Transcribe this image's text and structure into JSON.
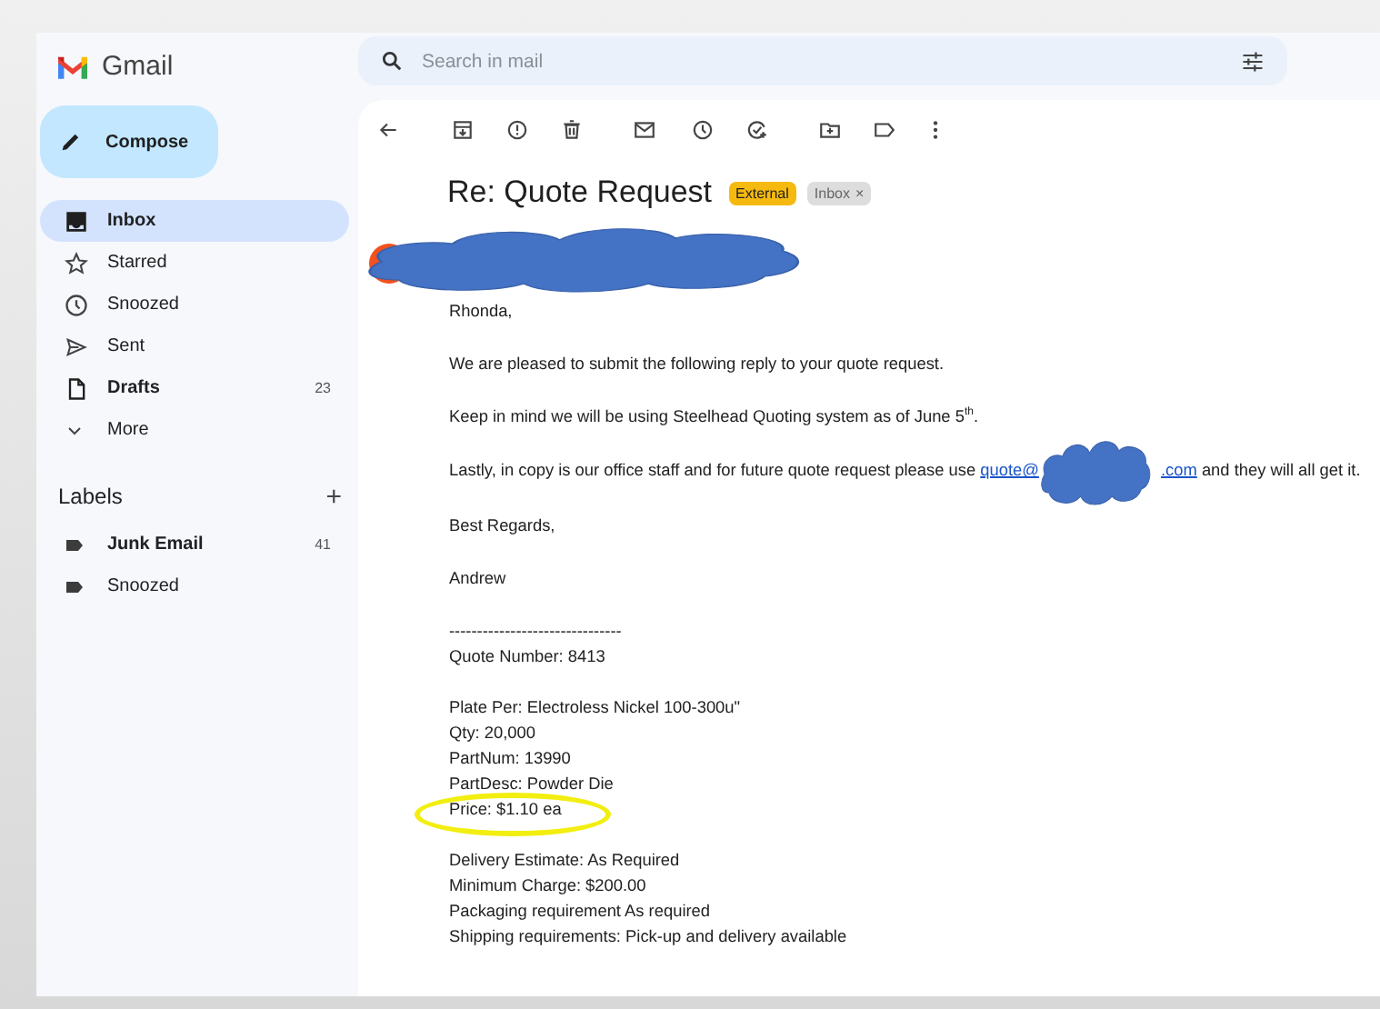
{
  "app": {
    "name": "Gmail"
  },
  "compose": {
    "label": "Compose"
  },
  "sidebar": {
    "items": [
      {
        "label": "Inbox",
        "selected": true,
        "unread": true
      },
      {
        "label": "Starred",
        "selected": false,
        "unread": false
      },
      {
        "label": "Snoozed",
        "selected": false,
        "unread": false
      },
      {
        "label": "Sent",
        "selected": false,
        "unread": false
      },
      {
        "label": "Drafts",
        "count": "23",
        "selected": false,
        "unread": true
      },
      {
        "label": "More",
        "selected": false,
        "unread": false
      }
    ]
  },
  "labels": {
    "title": "Labels",
    "add": "+",
    "items": [
      {
        "label": "Junk Email",
        "count": "41",
        "selected": false,
        "unread": true
      },
      {
        "label": "Snoozed",
        "selected": false,
        "unread": false
      }
    ]
  },
  "search": {
    "placeholder": "Search in mail"
  },
  "message": {
    "subject": "Re: Quote Request",
    "tags": [
      {
        "label": "External",
        "color": "#f6b90f",
        "removable": false
      },
      {
        "label": "Inbox",
        "color": "#dddddd",
        "removable": true,
        "remove": "×"
      }
    ],
    "sender": {
      "redacted": true
    },
    "body": [
      {
        "kind": "line",
        "text": "Rhonda,"
      },
      {
        "kind": "line",
        "text": "We are pleased to submit the following reply to your quote request."
      },
      {
        "kind": "line",
        "text": "Keep in mind we will be using Steelhead Quoting system as of June 5$^{th}$."
      },
      {
        "kind": "link",
        "before": "Lastly, in copy is our office staff and for future quote request please use ",
        "link_start": "quote@",
        "link_end": ".com",
        "redacted": true,
        "after": " and they will all get it."
      },
      {
        "kind": "line",
        "text": "Best Regards,"
      },
      {
        "kind": "line",
        "text": "Andrew"
      },
      {
        "kind": "list",
        "lines": [
          {
            "text": "-------------------------------",
            "circled": false
          },
          {
            "text": "Quote Number: 8413",
            "circled": false
          }
        ]
      },
      {
        "kind": "list",
        "lines": [
          {
            "text": "Plate Per: Electroless Nickel 100-300u\"",
            "circled": false
          },
          {
            "text": "Qty: 20,000",
            "circled": false
          },
          {
            "text": "PartNum: 13990",
            "circled": false
          },
          {
            "text": "PartDesc: Powder Die",
            "circled": false
          },
          {
            "text": "Price: $1.10 ea",
            "circled": true
          }
        ]
      },
      {
        "kind": "list",
        "lines": [
          {
            "text": "Delivery Estimate: As Required",
            "circled": false
          },
          {
            "text": "Minimum Charge: $200.00",
            "circled": false
          },
          {
            "text": "Packaging requirement As required",
            "circled": false
          },
          {
            "text": "Shipping requirements: Pick-up and delivery available",
            "circled": false
          }
        ]
      }
    ]
  }
}
